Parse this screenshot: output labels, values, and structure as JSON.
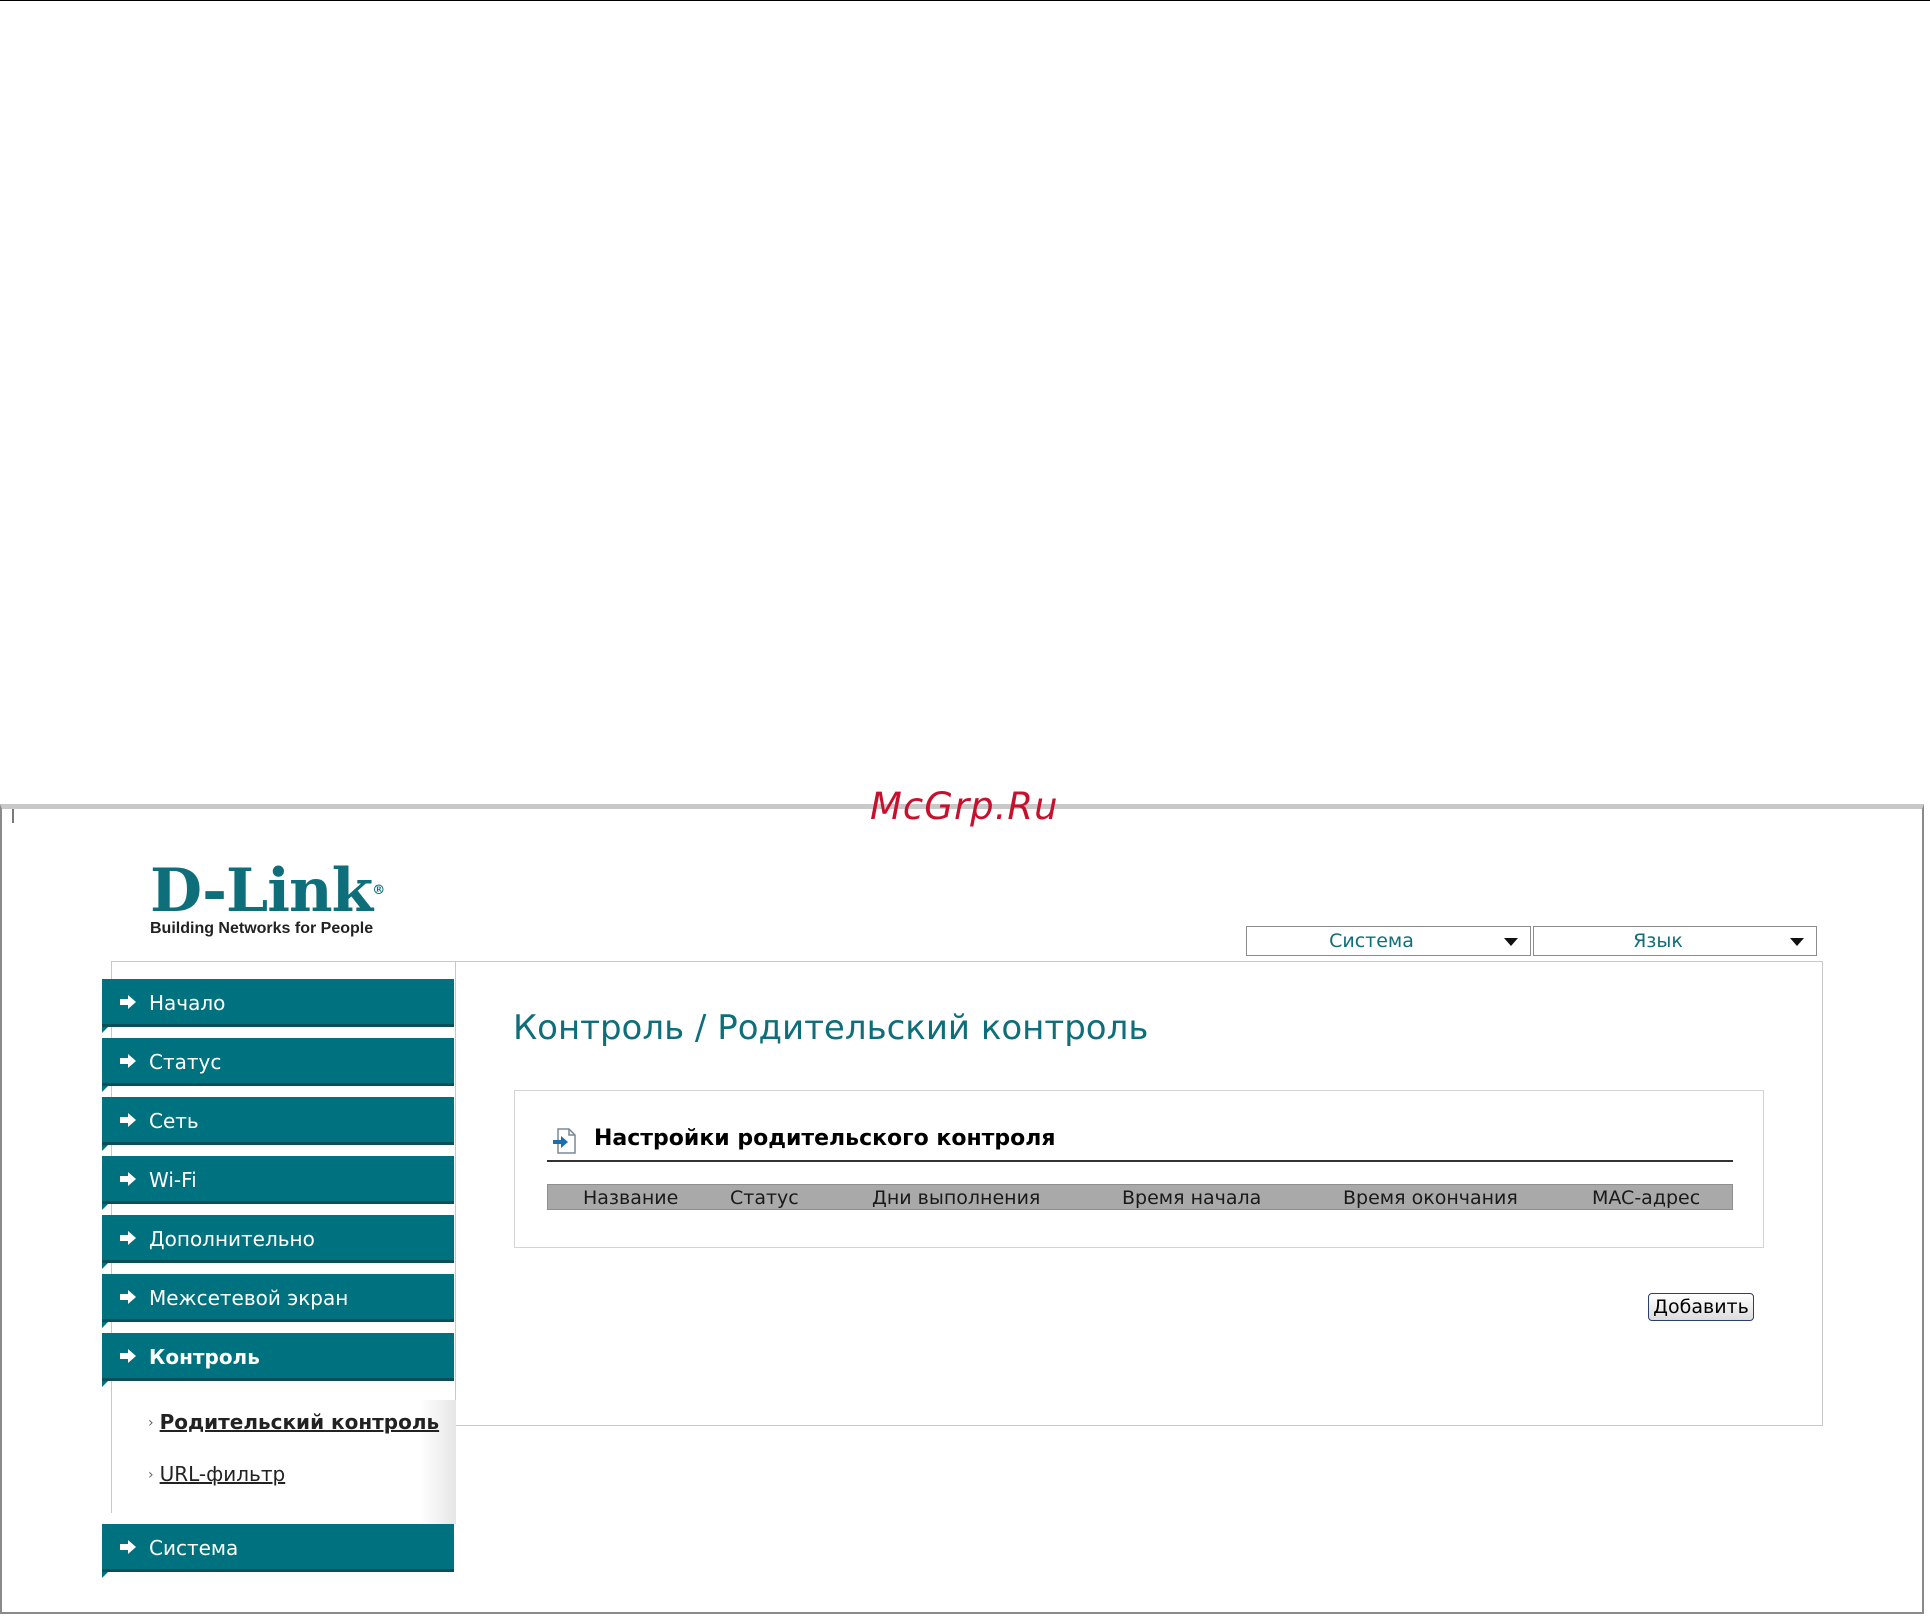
{
  "watermark": "McGrp.Ru",
  "logo": {
    "brand": "D-Link",
    "tagline": "Building Networks for People"
  },
  "header": {
    "system_dropdown": "Система",
    "language_dropdown": "Язык"
  },
  "sidebar": {
    "items": [
      {
        "label": "Начало"
      },
      {
        "label": "Статус"
      },
      {
        "label": "Сеть"
      },
      {
        "label": "Wi-Fi"
      },
      {
        "label": "Дополнительно"
      },
      {
        "label": "Межсетевой экран"
      },
      {
        "label": "Контроль",
        "active": true
      },
      {
        "label": "Система"
      }
    ],
    "subitems": [
      {
        "label": "Родительский контроль",
        "active": true
      },
      {
        "label": "URL-фильтр"
      }
    ]
  },
  "main": {
    "page_title": "Контроль /  Родительский контроль",
    "section": {
      "title": "Настройки родительского контроля",
      "columns": [
        "Название",
        "Статус",
        "Дни выполнения",
        "Время начала",
        "Время окончания",
        "MAC-адрес"
      ],
      "rows": []
    },
    "add_button": "Добавить"
  },
  "colors": {
    "accent": "#00727f",
    "title": "#0e6f7a",
    "watermark": "#c8102e"
  }
}
